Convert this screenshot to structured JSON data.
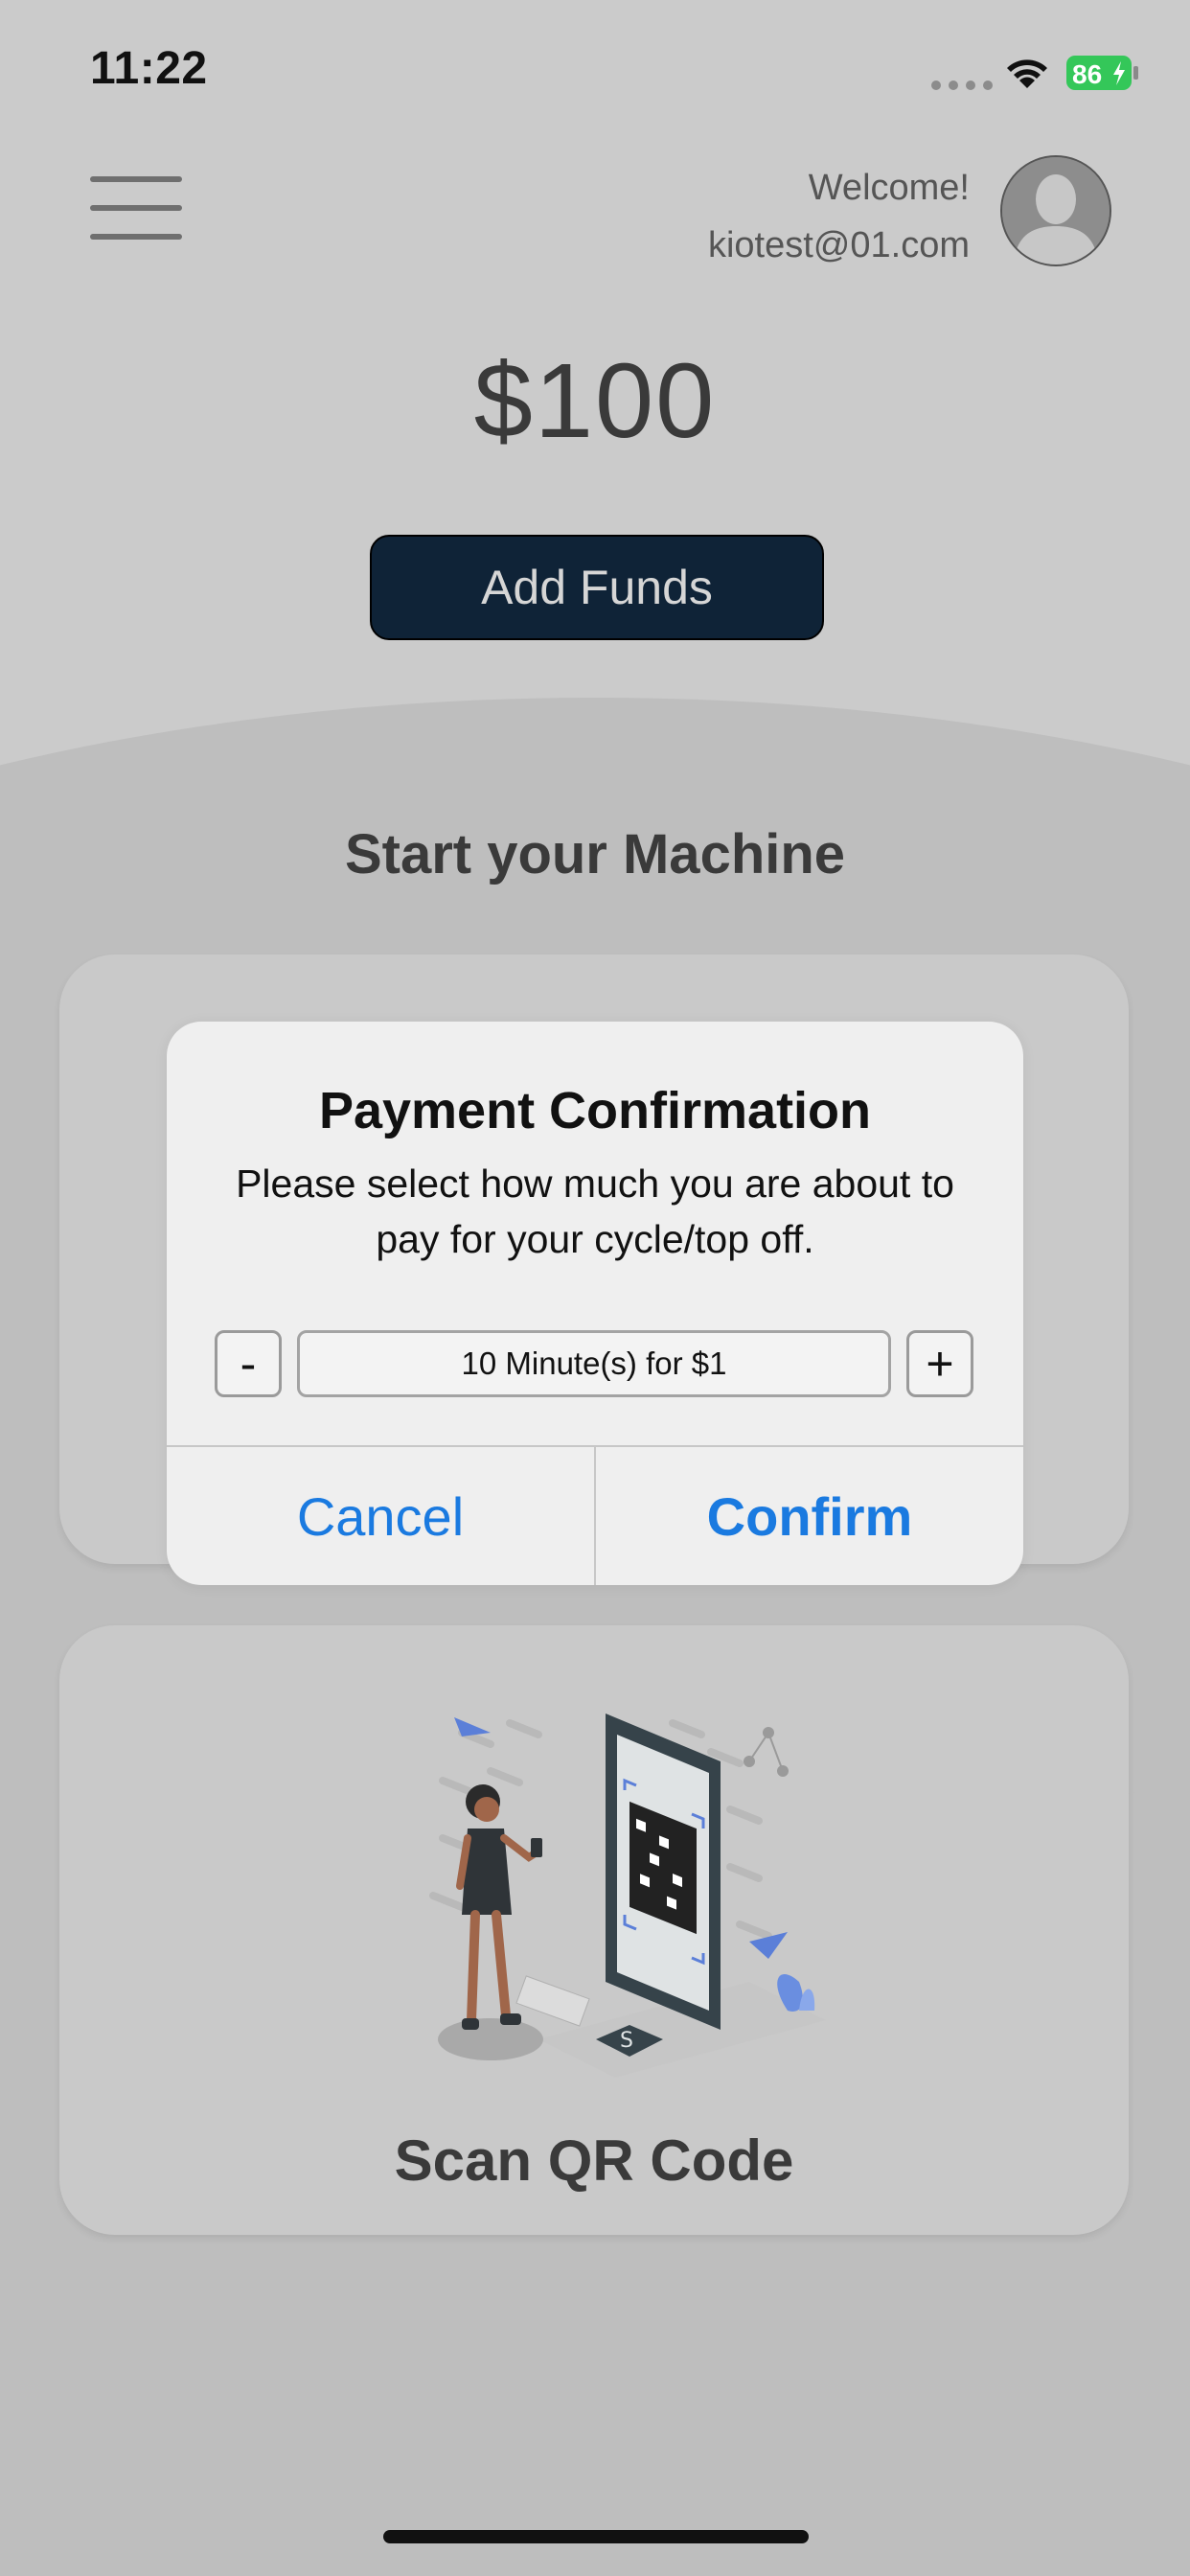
{
  "status_bar": {
    "time": "11:22",
    "battery_level": "86"
  },
  "header": {
    "greeting": "Welcome!",
    "email": "kiotest@01.com"
  },
  "wallet": {
    "balance": "$100",
    "add_funds_label": "Add Funds"
  },
  "section": {
    "title": "Start your Machine"
  },
  "qr_card": {
    "label": "Scan QR Code"
  },
  "dialog": {
    "title": "Payment Confirmation",
    "message": "Please select how much you are about to pay for your cycle/top off.",
    "decrement_label": "-",
    "increment_label": "+",
    "amount_value": "10 Minute(s) for $1",
    "cancel_label": "Cancel",
    "confirm_label": "Confirm"
  },
  "colors": {
    "accent": "#1a7ae0",
    "add_funds_bg": "#0f2337",
    "battery": "#34c759"
  }
}
